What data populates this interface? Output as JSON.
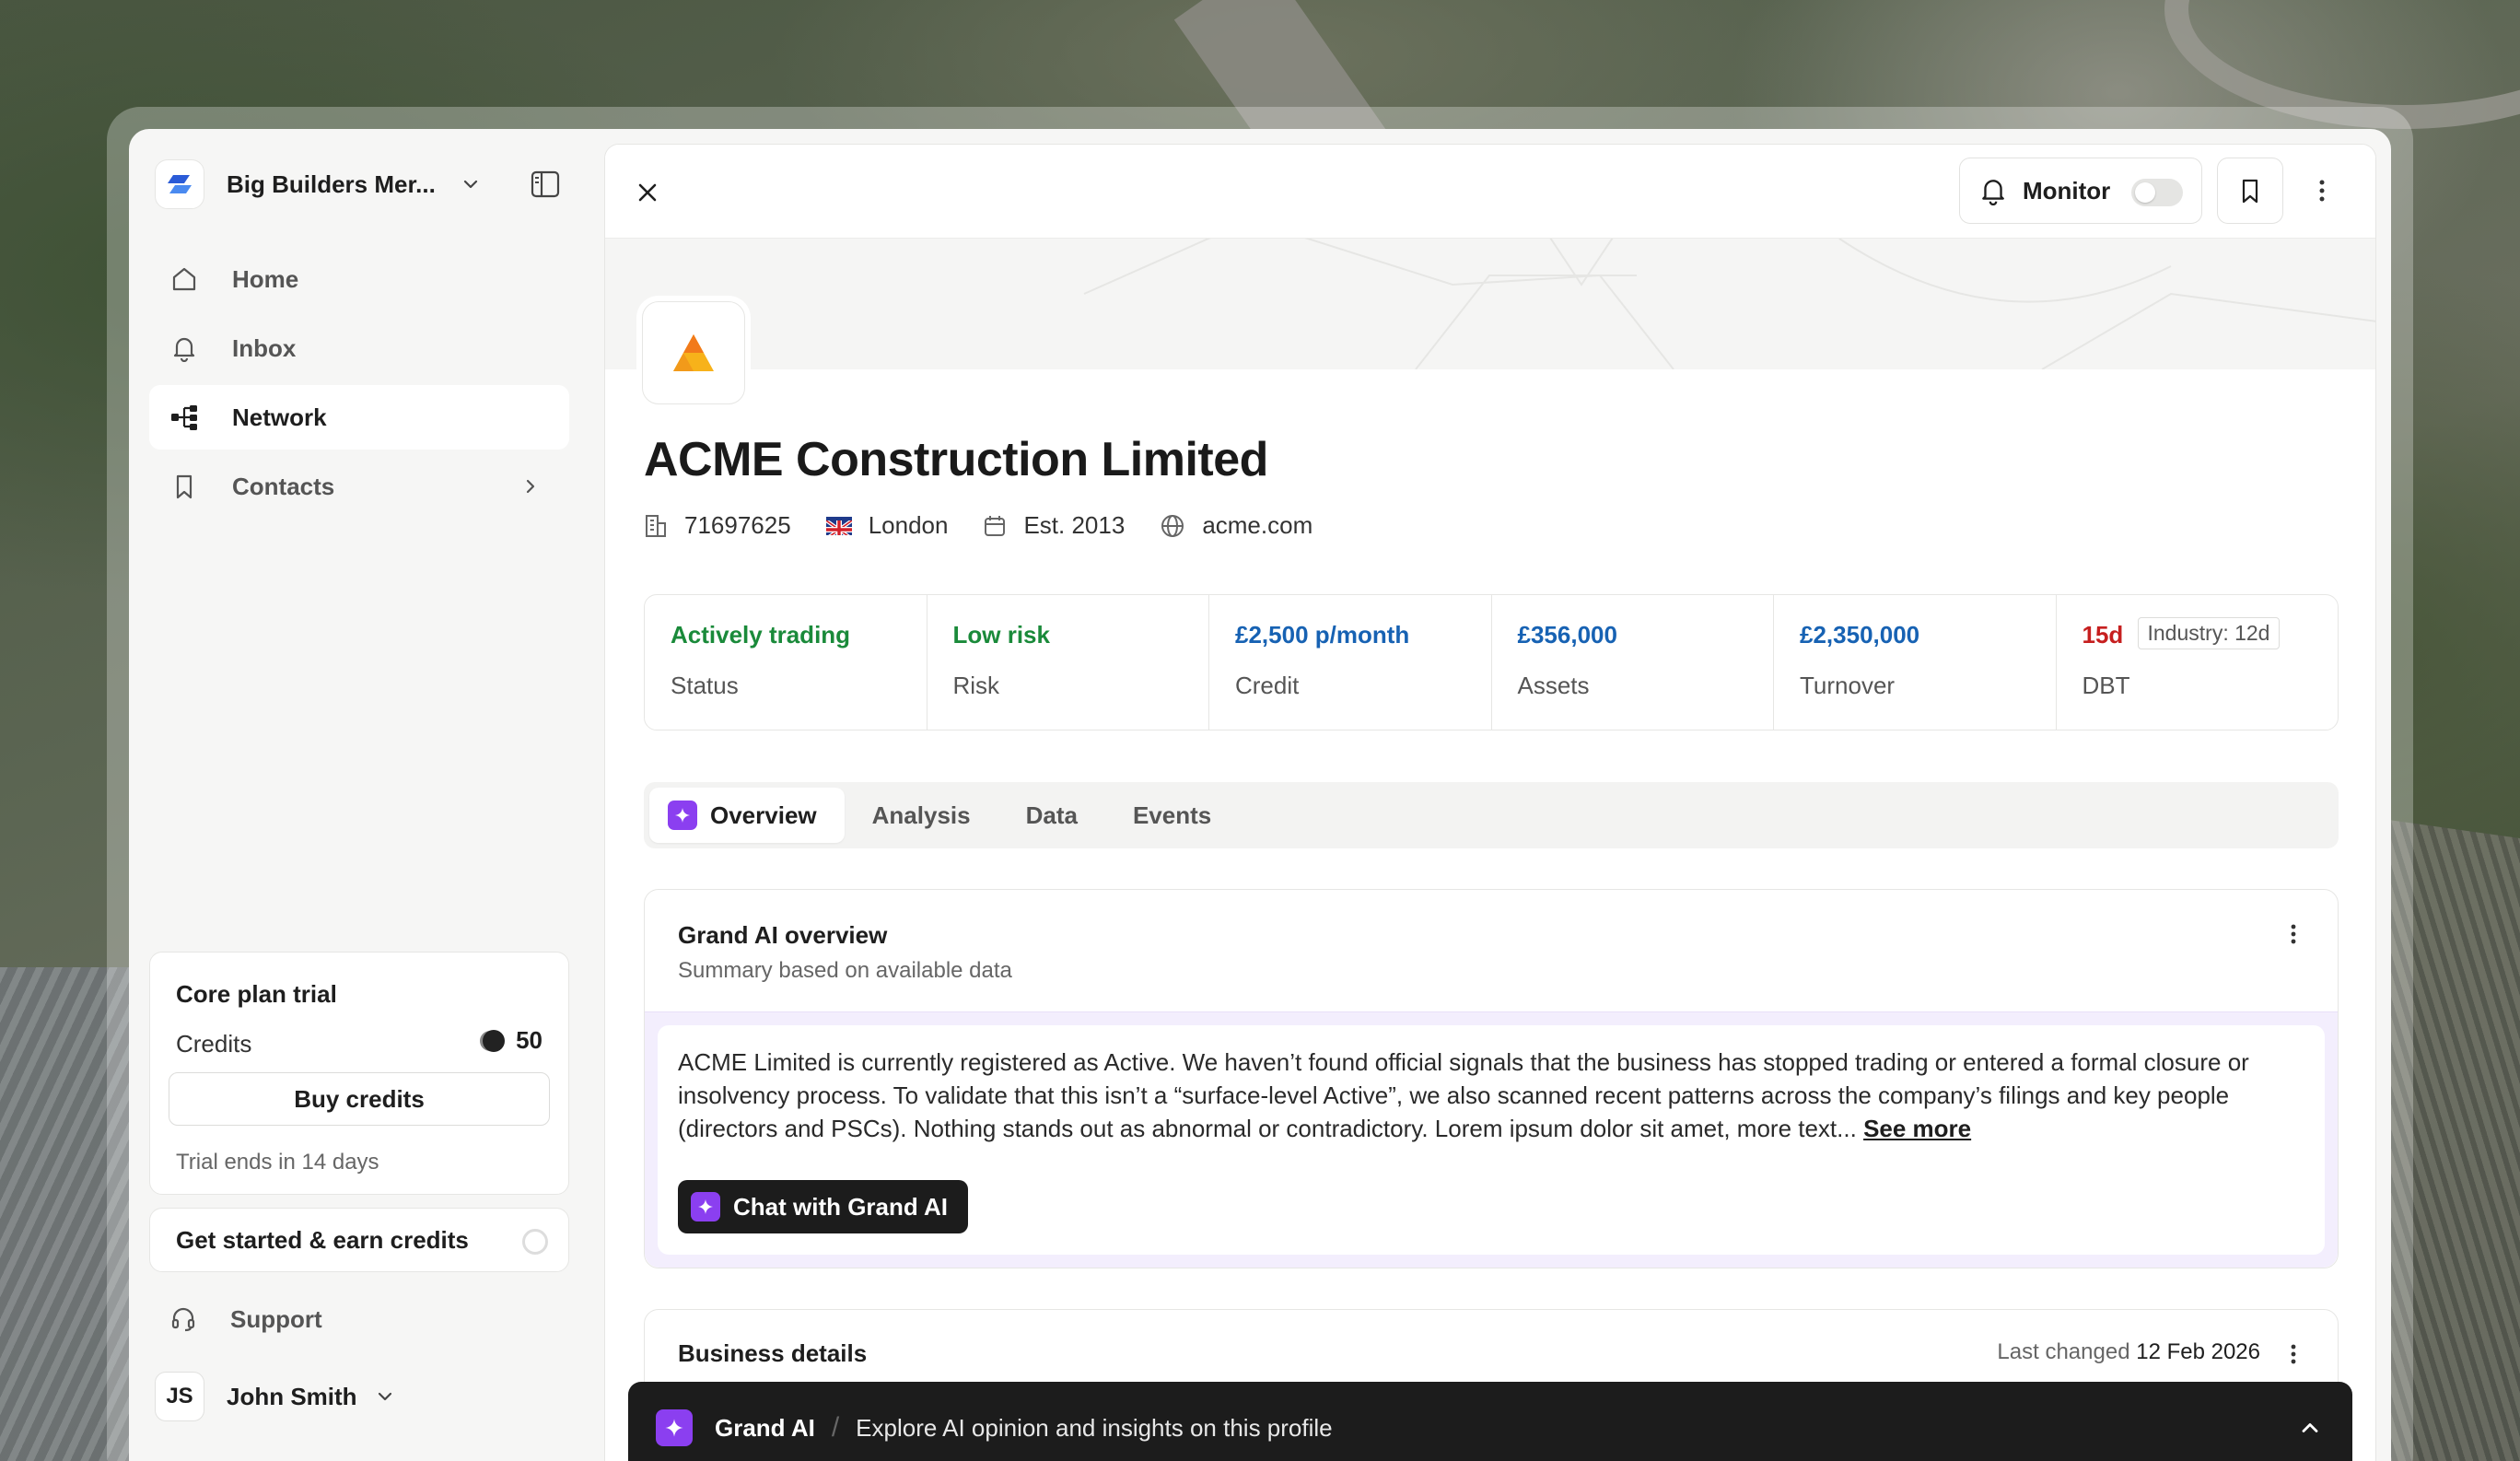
{
  "workspace": {
    "name": "Big Builders Mer..."
  },
  "nav": {
    "items": [
      {
        "label": "Home",
        "icon": "home-icon"
      },
      {
        "label": "Inbox",
        "icon": "bell-icon"
      },
      {
        "label": "Network",
        "icon": "network-icon",
        "active": true
      },
      {
        "label": "Contacts",
        "icon": "bookmark-icon"
      }
    ]
  },
  "trial": {
    "title": "Core plan trial",
    "credits_label": "Credits",
    "credits_value": "50",
    "buy_label": "Buy credits",
    "ends_text": "Trial ends in 14 days"
  },
  "earn": {
    "label": "Get started & earn credits"
  },
  "support": {
    "label": "Support"
  },
  "user": {
    "initials": "JS",
    "name": "John Smith"
  },
  "topbar": {
    "monitor_label": "Monitor",
    "monitor_on": false
  },
  "company": {
    "name": "ACME Construction Limited",
    "number": "71697625",
    "location": "London",
    "established": "Est. 2013",
    "website": "acme.com"
  },
  "stats": {
    "status": {
      "value": "Actively trading",
      "label": "Status"
    },
    "risk": {
      "value": "Low risk",
      "label": "Risk"
    },
    "credit": {
      "value": "£2,500 p/month",
      "label": "Credit"
    },
    "assets": {
      "value": "£356,000",
      "label": "Assets"
    },
    "turnover": {
      "value": "£2,350,000",
      "label": "Turnover"
    },
    "dbt": {
      "value": "15d",
      "industry": "Industry: 12d",
      "label": "DBT"
    }
  },
  "tabs": [
    "Overview",
    "Analysis",
    "Data",
    "Events"
  ],
  "ai_overview": {
    "title": "Grand AI overview",
    "subtitle": "Summary based on available data",
    "body": "ACME Limited is currently registered as Active. We haven’t found official signals that the business has stopped trading or entered a formal closure or insolvency process. To validate that this isn’t a “surface-level Active”, we also scanned recent patterns across the company’s filings and key people (directors and PSCs). Nothing stands out as abnormal or contradictory. Lorem ipsum dolor sit amet, more text...",
    "see_more": "See more",
    "chat_label": "Chat with Grand AI"
  },
  "business_details": {
    "title": "Business details",
    "changed_label": "Last changed",
    "changed_date": "12 Feb 2026"
  },
  "grand_bar": {
    "name": "Grand AI",
    "separator": "/",
    "description": "Explore AI opinion and insights on this profile"
  },
  "colors": {
    "accent_purple": "#8b3ff0",
    "status_green": "#1a8a3a",
    "value_blue": "#1762b3",
    "dbt_red": "#c61f1f",
    "brand_blue": "#2a5bd7",
    "logo_orange": "#f29a1a"
  }
}
